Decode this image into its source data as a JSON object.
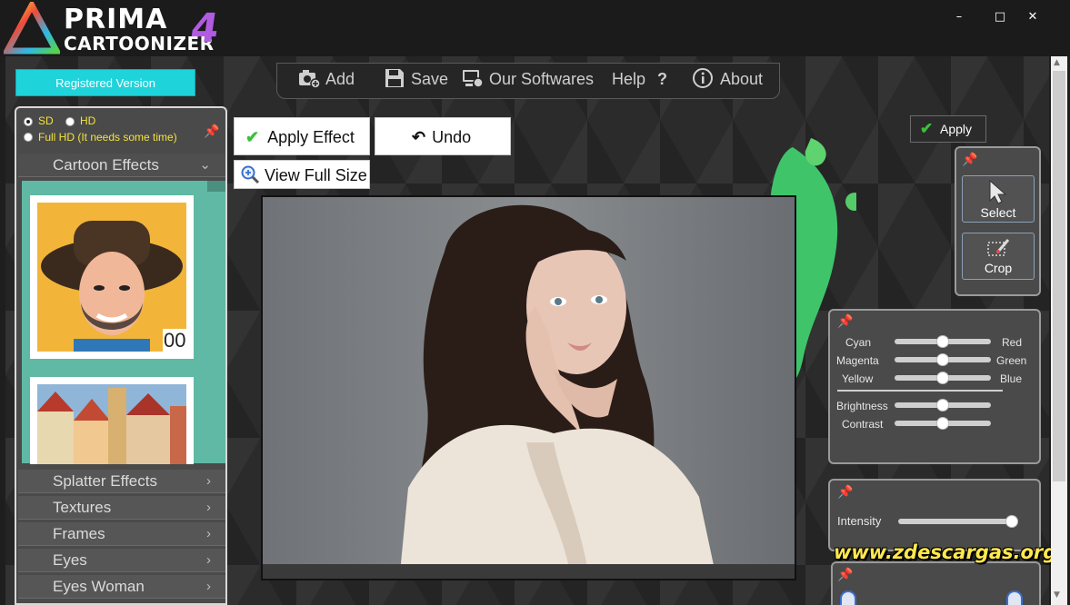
{
  "app": {
    "logo_prima": "PRIMA",
    "logo_cartoonizer": "CARTOONIZER",
    "logo_version": "4"
  },
  "window": {
    "minimize": "–",
    "maximize": "□",
    "close": "✕"
  },
  "left": {
    "registered": "Registered Version",
    "quality": [
      {
        "label": "SD",
        "selected": true
      },
      {
        "label": "HD",
        "selected": false
      },
      {
        "label": "Full HD (It needs some time)",
        "selected": false
      }
    ],
    "categories": [
      {
        "label": "Cartoon Effects",
        "expanded": true
      },
      {
        "label": "Splatter Effects",
        "expanded": false
      },
      {
        "label": "Textures",
        "expanded": false
      },
      {
        "label": "Frames",
        "expanded": false
      },
      {
        "label": "Eyes",
        "expanded": false
      },
      {
        "label": "Eyes Woman",
        "expanded": false
      }
    ],
    "thumb_number": "00"
  },
  "toolbar": {
    "add": "Add",
    "save": "Save",
    "softwares": "Our Softwares",
    "help": "Help",
    "help_mark": "?",
    "about": "About"
  },
  "actions": {
    "apply_effect": "Apply Effect",
    "undo": "Undo",
    "view_full_size": "View Full Size"
  },
  "right": {
    "apply": "Apply",
    "select": "Select",
    "crop": "Crop",
    "color_sliders": [
      {
        "left": "Cyan",
        "right": "Red",
        "value": 0.5
      },
      {
        "left": "Magenta",
        "right": "Green",
        "value": 0.5
      },
      {
        "left": "Yellow",
        "right": "Blue",
        "value": 0.5
      }
    ],
    "tone_sliders": [
      {
        "label": "Brightness",
        "value": 0.5
      },
      {
        "label": "Contrast",
        "value": 0.5
      }
    ],
    "intensity": {
      "label": "Intensity",
      "value": 1.0
    }
  },
  "watermark": "www.zdescargas.org",
  "colors": {
    "accent": "#1fd3db",
    "check": "#3bbf3b",
    "option_text": "#f3e33a",
    "watermark": "#ffe94d"
  }
}
